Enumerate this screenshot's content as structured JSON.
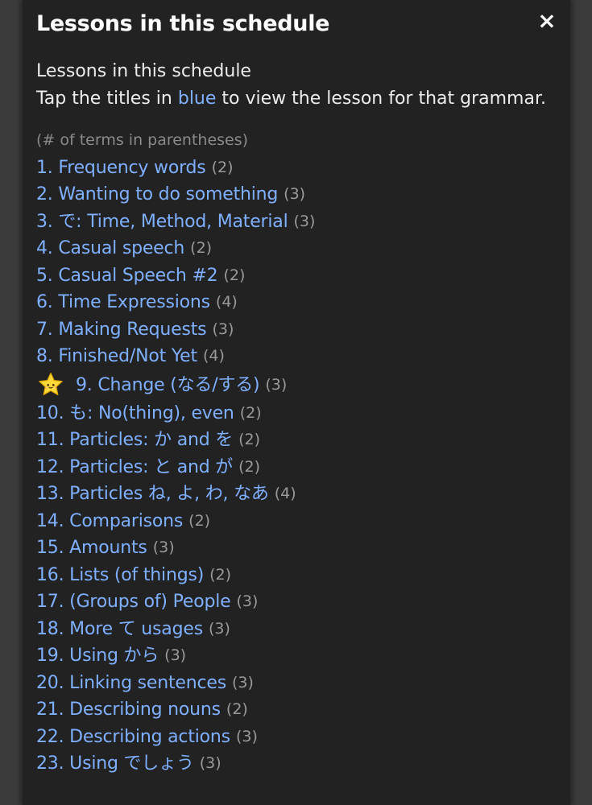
{
  "modal": {
    "title": "Lessons in this schedule",
    "close_label": "×"
  },
  "intro": {
    "line1": "Lessons in this schedule",
    "line2_before": "Tap the titles in ",
    "line2_accent": "blue",
    "line2_after": " to view the lesson for that grammar."
  },
  "note": "(# of terms in parentheses)",
  "colors": {
    "modal_bg": "#222222",
    "link": "#7fb0ff",
    "count": "#9a9a9a",
    "note": "#8a8a8a",
    "star": "#ffd83a"
  },
  "lessons": [
    {
      "title": "1. Frequency words",
      "count": "(2)"
    },
    {
      "title": "2. Wanting to do something",
      "count": "(3)"
    },
    {
      "title": "3. で: Time, Method, Material",
      "count": "(3)"
    },
    {
      "title": "4. Casual speech",
      "count": "(2)"
    },
    {
      "title": "5. Casual Speech #2",
      "count": "(2)"
    },
    {
      "title": "6. Time Expressions",
      "count": "(4)"
    },
    {
      "title": "7. Making Requests",
      "count": "(3)"
    },
    {
      "title": "8. Finished/Not Yet",
      "count": "(4)"
    },
    {
      "title": "9. Change (なる/する)",
      "count": "(3)",
      "icon": "star-icon"
    },
    {
      "title": "10. も: No(thing), even",
      "count": "(2)"
    },
    {
      "title": "11. Particles: か and を",
      "count": "(2)"
    },
    {
      "title": "12. Particles: と and が",
      "count": "(2)"
    },
    {
      "title": "13. Particles ね, よ, わ, なあ",
      "count": "(4)"
    },
    {
      "title": "14. Comparisons",
      "count": "(2)"
    },
    {
      "title": "15. Amounts",
      "count": "(3)"
    },
    {
      "title": "16. Lists (of things)",
      "count": "(2)"
    },
    {
      "title": "17. (Groups of) People",
      "count": "(3)"
    },
    {
      "title": "18. More て usages",
      "count": "(3)"
    },
    {
      "title": "19. Using から",
      "count": "(3)"
    },
    {
      "title": "20. Linking sentences",
      "count": "(3)"
    },
    {
      "title": "21. Describing nouns",
      "count": "(2)"
    },
    {
      "title": "22. Describing actions",
      "count": "(3)"
    },
    {
      "title": "23. Using でしょう",
      "count": "(3)"
    }
  ]
}
